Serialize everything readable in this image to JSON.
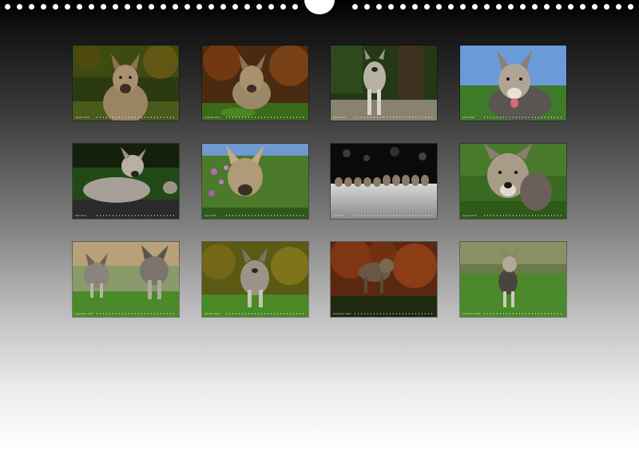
{
  "calendar": {
    "months": [
      {
        "caption": "Januar 2018"
      },
      {
        "caption": "Februar 2018"
      },
      {
        "caption": "März 2018"
      },
      {
        "caption": "April 2018"
      },
      {
        "caption": "Mai 2018"
      },
      {
        "caption": "Juni 2018"
      },
      {
        "caption": "Juli 2018"
      },
      {
        "caption": "August 2018"
      },
      {
        "caption": "September 2018"
      },
      {
        "caption": "Oktober 2018"
      },
      {
        "caption": "November 2018"
      },
      {
        "caption": "Dezember 2018"
      }
    ]
  },
  "colors": {
    "background_top": "#000000",
    "background_bottom": "#ffffff",
    "binding_holes": "#ffffff"
  }
}
